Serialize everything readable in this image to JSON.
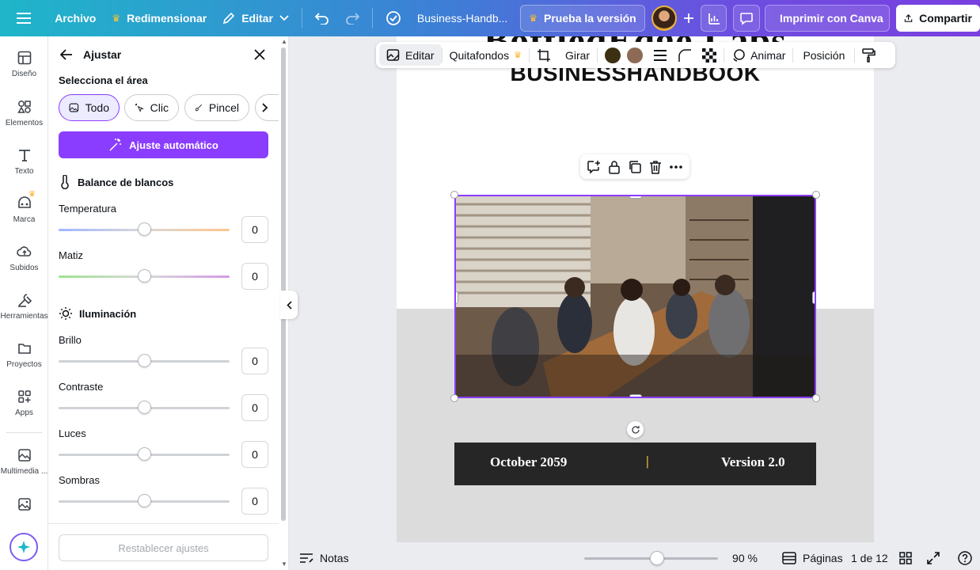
{
  "topbar": {
    "menu_label": "Archivo",
    "resize_label": "Redimensionar",
    "edit_label": "Editar",
    "doc_title": "Business-Handb...",
    "trial_label": "Prueba la versión ...",
    "print_label": "Imprimir con Canva",
    "share_label": "Compartir"
  },
  "leftnav": {
    "items": [
      {
        "label": "Diseño",
        "icon": "layout-icon"
      },
      {
        "label": "Elementos",
        "icon": "shapes-icon"
      },
      {
        "label": "Texto",
        "icon": "text-icon"
      },
      {
        "label": "Marca",
        "icon": "brand-icon"
      },
      {
        "label": "Subidos",
        "icon": "cloud-upload-icon"
      },
      {
        "label": "Herramientas",
        "icon": "tools-icon"
      },
      {
        "label": "Proyectos",
        "icon": "folder-icon"
      },
      {
        "label": "Apps",
        "icon": "apps-icon"
      },
      {
        "label": "Multimedia ...",
        "icon": "media-icon"
      }
    ]
  },
  "panel": {
    "title": "Ajustar",
    "area_label": "Selecciona el área",
    "area_options": [
      "Todo",
      "Clic",
      "Pincel"
    ],
    "auto_label": "Ajuste automático",
    "white_balance_title": "Balance de blancos",
    "lighting_title": "Iluminación",
    "sliders": {
      "temperatura": {
        "label": "Temperatura",
        "value": "0"
      },
      "matiz": {
        "label": "Matiz",
        "value": "0"
      },
      "brillo": {
        "label": "Brillo",
        "value": "0"
      },
      "contraste": {
        "label": "Contraste",
        "value": "0"
      },
      "luces": {
        "label": "Luces",
        "value": "0"
      },
      "sombras": {
        "label": "Sombras",
        "value": "0"
      }
    },
    "reset_label": "Restablecer ajustes"
  },
  "toolbar": {
    "edit_label": "Editar",
    "bg_remove_label": "Quitafondos",
    "rotate_label": "Girar",
    "animate_label": "Animar",
    "position_label": "Posición",
    "color1": "#3d2f12",
    "color2": "#8c6a55"
  },
  "canvas": {
    "title_partial": "BottledEdge Labs",
    "subtitle": "BUSINESSHANDBOOK",
    "footer_date": "October 2059",
    "footer_separator": "|",
    "footer_version": "Version 2.0"
  },
  "bottombar": {
    "notes_label": "Notas",
    "zoom_label": "90 %",
    "pages_label": "Páginas",
    "page_counter": "1 de 12"
  },
  "colors": {
    "accent": "#8b3dff",
    "selection": "#8b3dff"
  }
}
